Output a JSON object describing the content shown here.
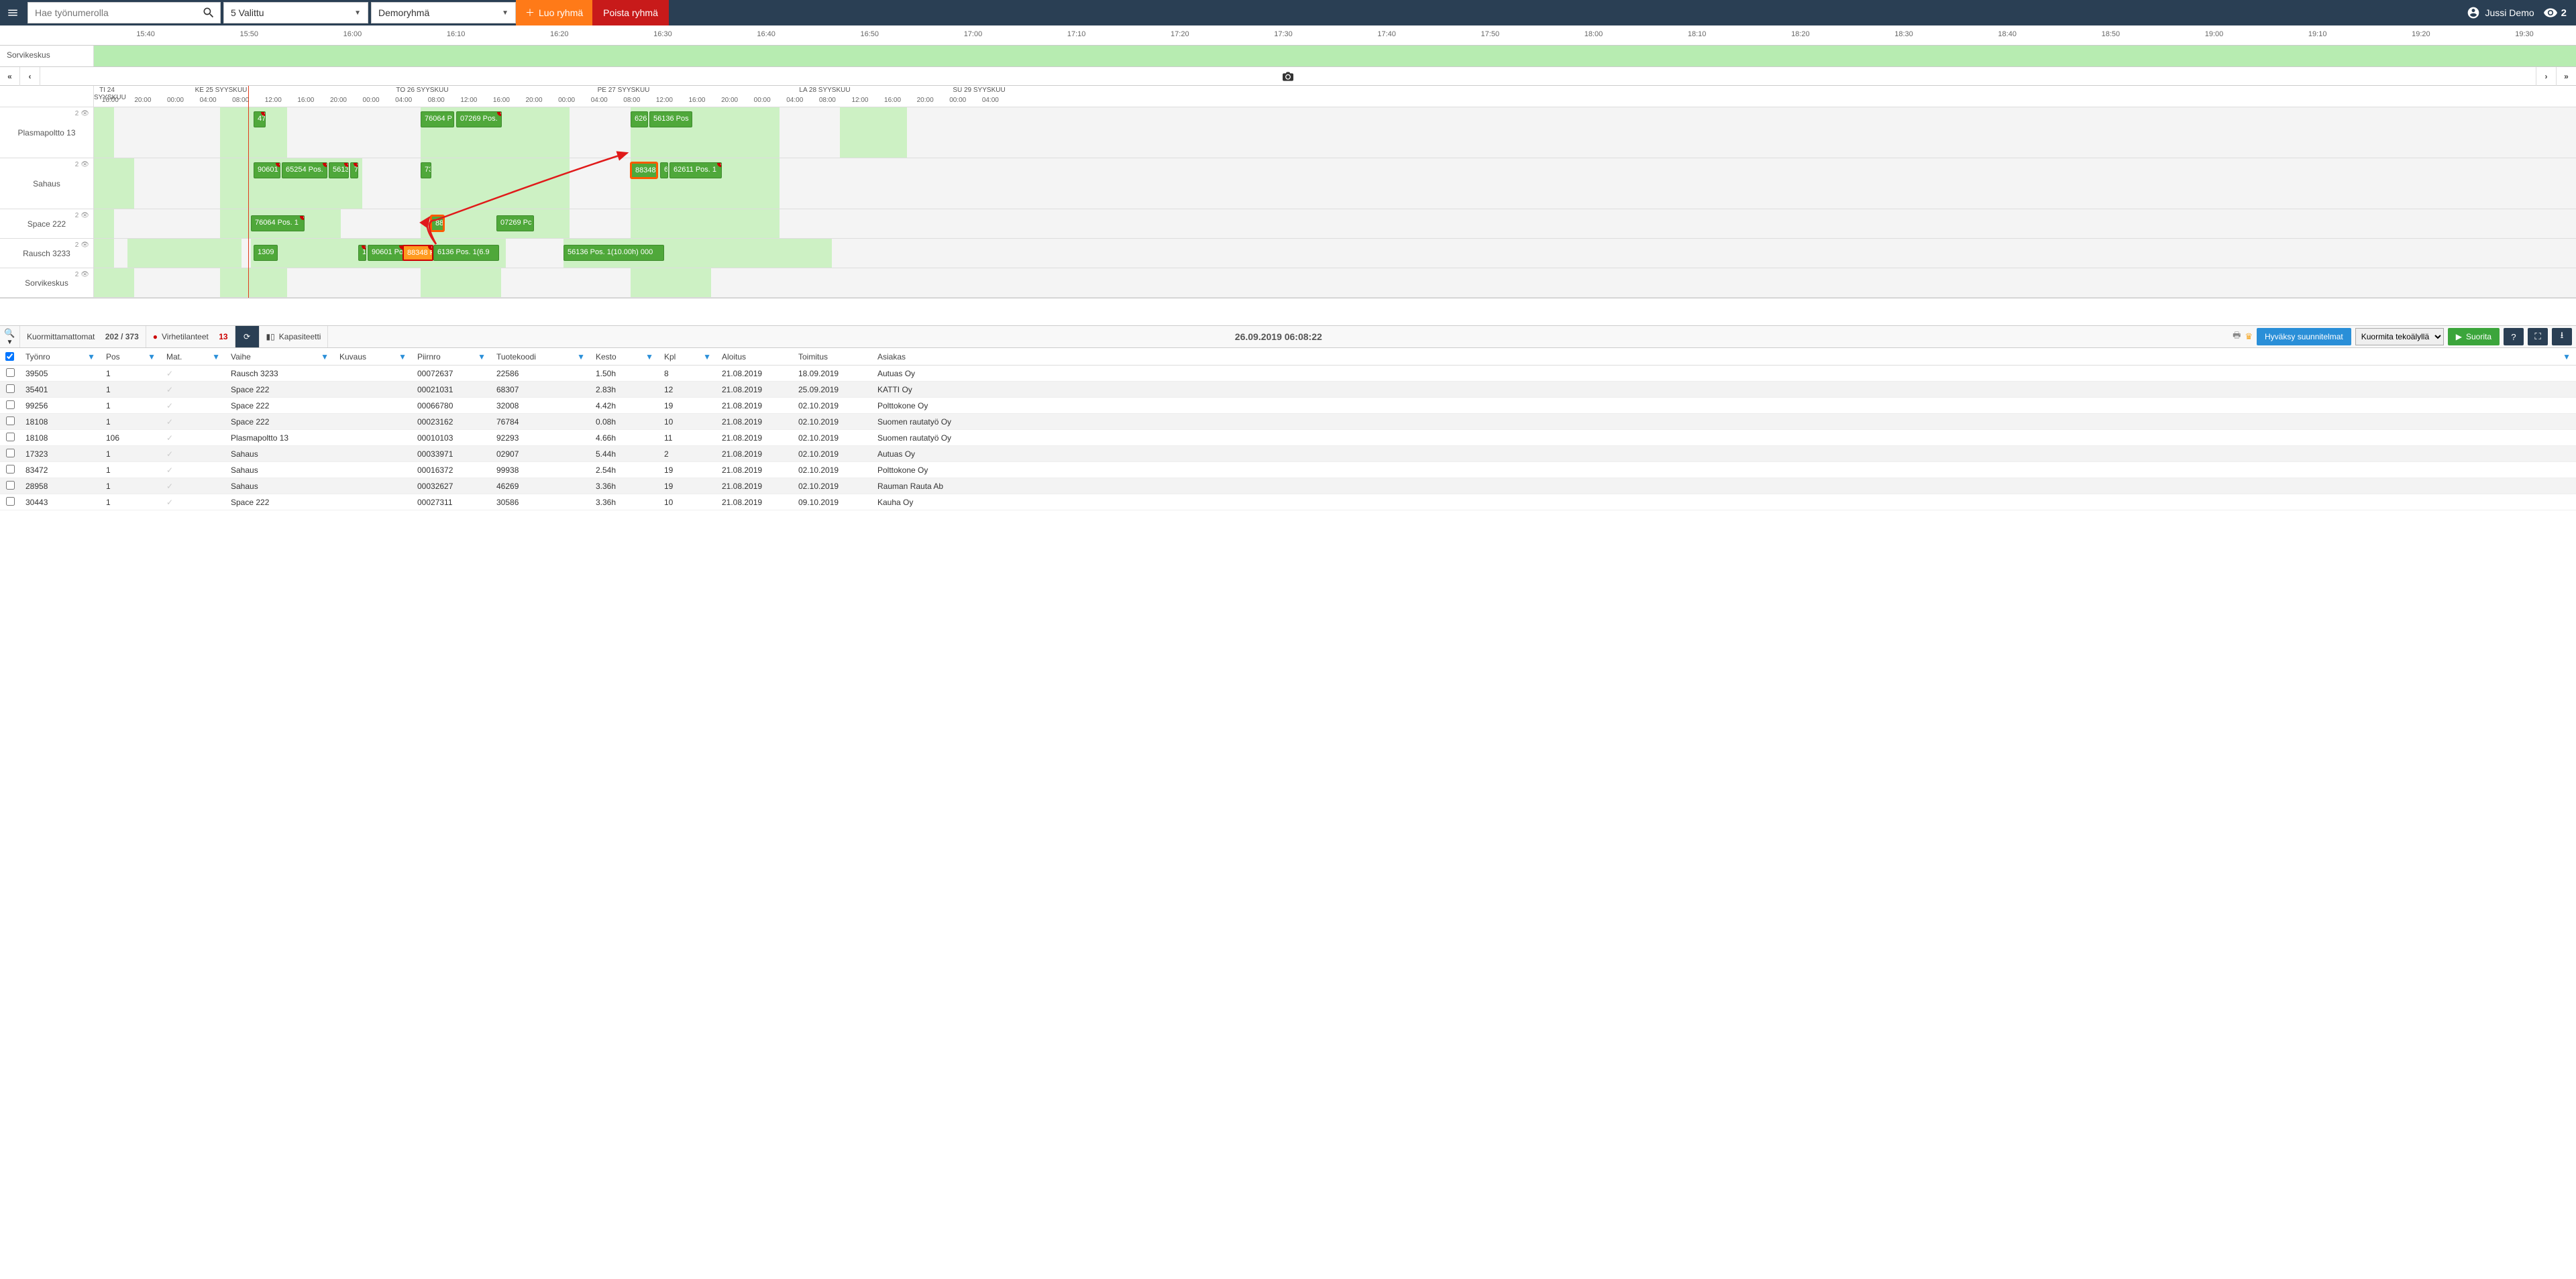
{
  "topbar": {
    "search_placeholder": "Hae työnumerolla",
    "selected_label": "5 Valittu",
    "group_label": "Demoryhmä",
    "create_group": "Luo ryhmä",
    "delete_group": "Poista ryhmä",
    "user_name": "Jussi Demo",
    "viewer_count": "2"
  },
  "mini_strip": {
    "hours": [
      "15:40",
      "15:50",
      "16:00",
      "16:10",
      "16:20",
      "16:30",
      "16:40",
      "16:50",
      "17:00",
      "17:10",
      "17:20",
      "17:30",
      "17:40",
      "17:50",
      "18:00",
      "18:10",
      "18:20",
      "18:30",
      "18:40",
      "18:50",
      "19:00",
      "19:10",
      "19:20",
      "19:30"
    ],
    "lane_label": "Sorvikeskus"
  },
  "gantt": {
    "days": [
      "TI 24 SYYSKUU",
      "KE 25 SYYSKUU",
      "TO 26 SYYSKUU",
      "PE 27 SYYSKUU",
      "LA 28 SYYSKUU",
      "SU 29 SYYSKUU"
    ],
    "hours": [
      "16:00",
      "20:00",
      "00:00",
      "04:00",
      "08:00",
      "12:00",
      "16:00",
      "20:00",
      "00:00",
      "04:00",
      "08:00",
      "12:00",
      "16:00",
      "20:00",
      "00:00",
      "04:00",
      "08:00",
      "12:00",
      "16:00",
      "20:00",
      "00:00",
      "04:00",
      "08:00",
      "12:00",
      "16:00",
      "20:00",
      "00:00",
      "04:00"
    ],
    "resources": [
      {
        "name": "Plasmapoltto 13",
        "stat": "2"
      },
      {
        "name": "Sahaus",
        "stat": "2"
      },
      {
        "name": "Space 222",
        "stat": "2"
      },
      {
        "name": "Rausch 3233",
        "stat": "2"
      },
      {
        "name": "Sorvikeskus",
        "stat": "2"
      }
    ],
    "tasks": {
      "plasma": [
        {
          "label": "47",
          "alert": true
        },
        {
          "label": "76064 P"
        },
        {
          "label": "07269 Pos."
        },
        {
          "label": "626"
        },
        {
          "label": "56136 Pos"
        }
      ],
      "sahaus": [
        {
          "label": "90601",
          "alert": true
        },
        {
          "label": "65254 Pos.",
          "alert": true
        },
        {
          "label": "5613",
          "alert": true
        },
        {
          "label": "7",
          "alert": true
        },
        {
          "label": "73"
        },
        {
          "label": "88348",
          "highlighted": true
        },
        {
          "label": "6"
        },
        {
          "label": "62611 Pos. 1",
          "alert": true
        }
      ],
      "space": [
        {
          "label": "76064 Pos. 1",
          "alert": true
        },
        {
          "label": "88",
          "highlighted": true
        },
        {
          "label": "07269 Pc"
        }
      ],
      "rausch": [
        {
          "label": "1309"
        },
        {
          "label": "1",
          "alert": true
        },
        {
          "label": "90601 Po",
          "alert": true
        },
        {
          "label": "88348 P",
          "highlighted": true,
          "alert": true
        },
        {
          "label": "6136 Pos. 1(6.9"
        },
        {
          "label": "56136 Pos. 1(10.00h) 000"
        }
      ]
    }
  },
  "bottom_toolbar": {
    "unassigned_label": "Kuormittamattomat",
    "unassigned_count": "202 / 373",
    "errors_label": "Virhetilanteet",
    "errors_count": "13",
    "capacity_label": "Kapasiteetti",
    "timestamp": "26.09.2019 06:08:22",
    "approve_label": "Hyväksy suunnitelmat",
    "ai_select": "Kuormita tekoälyllä",
    "run_label": "Suorita"
  },
  "table": {
    "headers": {
      "tyo": "Työnro",
      "pos": "Pos",
      "mat": "Mat.",
      "vaihe": "Vaihe",
      "kuvaus": "Kuvaus",
      "piir": "Piirnro",
      "tuote": "Tuotekoodi",
      "kesto": "Kesto",
      "kpl": "Kpl",
      "aloitus": "Aloitus",
      "toimitus": "Toimitus",
      "asiakas": "Asiakas"
    },
    "rows": [
      {
        "tyo": "39505",
        "pos": "1",
        "vaihe": "Rausch 3233",
        "piir": "00072637",
        "tuote": "22586",
        "kesto": "1.50h",
        "kpl": "8",
        "aloitus": "21.08.2019",
        "toimitus": "18.09.2019",
        "asiakas": "Autuas Oy"
      },
      {
        "tyo": "35401",
        "pos": "1",
        "vaihe": "Space 222",
        "piir": "00021031",
        "tuote": "68307",
        "kesto": "2.83h",
        "kpl": "12",
        "aloitus": "21.08.2019",
        "toimitus": "25.09.2019",
        "asiakas": "KATTI Oy"
      },
      {
        "tyo": "99256",
        "pos": "1",
        "vaihe": "Space 222",
        "piir": "00066780",
        "tuote": "32008",
        "kesto": "4.42h",
        "kpl": "19",
        "aloitus": "21.08.2019",
        "toimitus": "02.10.2019",
        "asiakas": "Polttokone Oy"
      },
      {
        "tyo": "18108",
        "pos": "1",
        "vaihe": "Space 222",
        "piir": "00023162",
        "tuote": "76784",
        "kesto": "0.08h",
        "kpl": "10",
        "aloitus": "21.08.2019",
        "toimitus": "02.10.2019",
        "asiakas": "Suomen rautatyö Oy"
      },
      {
        "tyo": "18108",
        "pos": "106",
        "vaihe": "Plasmapoltto 13",
        "piir": "00010103",
        "tuote": "92293",
        "kesto": "4.66h",
        "kpl": "11",
        "aloitus": "21.08.2019",
        "toimitus": "02.10.2019",
        "asiakas": "Suomen rautatyö Oy"
      },
      {
        "tyo": "17323",
        "pos": "1",
        "vaihe": "Sahaus",
        "piir": "00033971",
        "tuote": "02907",
        "kesto": "5.44h",
        "kpl": "2",
        "aloitus": "21.08.2019",
        "toimitus": "02.10.2019",
        "asiakas": "Autuas Oy"
      },
      {
        "tyo": "83472",
        "pos": "1",
        "vaihe": "Sahaus",
        "piir": "00016372",
        "tuote": "99938",
        "kesto": "2.54h",
        "kpl": "19",
        "aloitus": "21.08.2019",
        "toimitus": "02.10.2019",
        "asiakas": "Polttokone Oy"
      },
      {
        "tyo": "28958",
        "pos": "1",
        "vaihe": "Sahaus",
        "piir": "00032627",
        "tuote": "46269",
        "kesto": "3.36h",
        "kpl": "19",
        "aloitus": "21.08.2019",
        "toimitus": "02.10.2019",
        "asiakas": "Rauman Rauta Ab"
      },
      {
        "tyo": "30443",
        "pos": "1",
        "vaihe": "Space 222",
        "piir": "00027311",
        "tuote": "30586",
        "kesto": "3.36h",
        "kpl": "10",
        "aloitus": "21.08.2019",
        "toimitus": "09.10.2019",
        "asiakas": "Kauha Oy"
      }
    ]
  }
}
